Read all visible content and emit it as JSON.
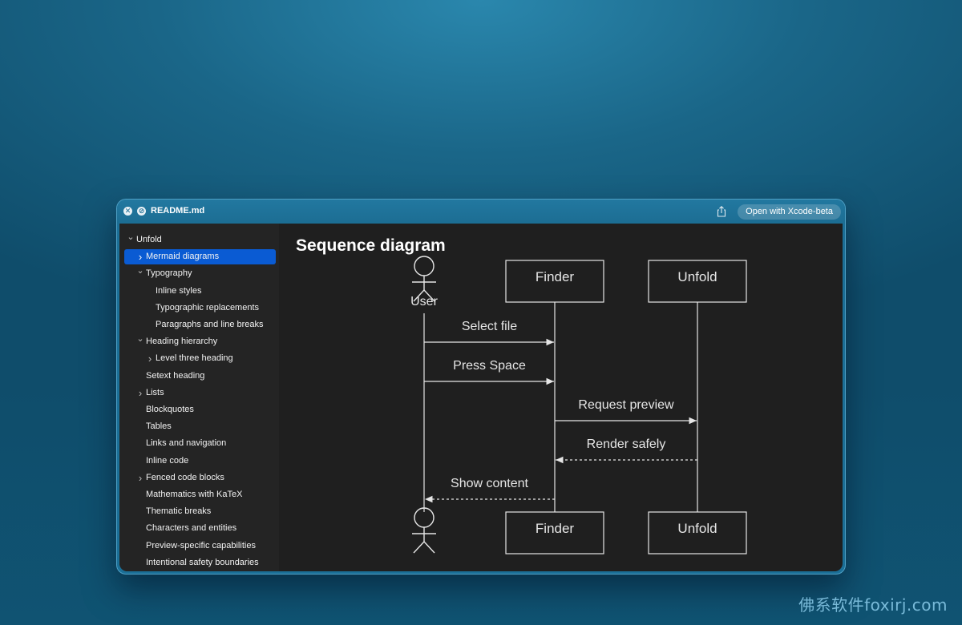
{
  "window": {
    "title": "README.md",
    "open_button_label": "Open with Xcode-beta"
  },
  "sidebar": {
    "items": [
      {
        "label": "Unfold",
        "level": 0,
        "chevron": "down"
      },
      {
        "label": "Mermaid diagrams",
        "level": 1,
        "chevron": "right",
        "selected": true
      },
      {
        "label": "Typography",
        "level": 1,
        "chevron": "down"
      },
      {
        "label": "Inline styles",
        "level": 2,
        "chevron": ""
      },
      {
        "label": "Typographic replacements",
        "level": 2,
        "chevron": ""
      },
      {
        "label": "Paragraphs and line breaks",
        "level": 2,
        "chevron": ""
      },
      {
        "label": "Heading hierarchy",
        "level": 1,
        "chevron": "down"
      },
      {
        "label": "Level three heading",
        "level": 2,
        "chevron": "right"
      },
      {
        "label": "Setext heading",
        "level": 1,
        "chevron": ""
      },
      {
        "label": "Lists",
        "level": 1,
        "chevron": "right"
      },
      {
        "label": "Blockquotes",
        "level": 1,
        "chevron": ""
      },
      {
        "label": "Tables",
        "level": 1,
        "chevron": ""
      },
      {
        "label": "Links and navigation",
        "level": 1,
        "chevron": ""
      },
      {
        "label": "Inline code",
        "level": 1,
        "chevron": ""
      },
      {
        "label": "Fenced code blocks",
        "level": 1,
        "chevron": "right"
      },
      {
        "label": "Mathematics with KaTeX",
        "level": 1,
        "chevron": ""
      },
      {
        "label": "Thematic breaks",
        "level": 1,
        "chevron": ""
      },
      {
        "label": "Characters and entities",
        "level": 1,
        "chevron": ""
      },
      {
        "label": "Preview-specific capabilities",
        "level": 1,
        "chevron": ""
      },
      {
        "label": "Intentional safety boundaries",
        "level": 1,
        "chevron": ""
      }
    ]
  },
  "main": {
    "heading": "Sequence diagram",
    "diagram": {
      "participants": [
        "User",
        "Finder",
        "Unfold"
      ],
      "messages": [
        {
          "from": "User",
          "to": "Finder",
          "label": "Select file",
          "style": "solid"
        },
        {
          "from": "User",
          "to": "Finder",
          "label": "Press Space",
          "style": "solid"
        },
        {
          "from": "Finder",
          "to": "Unfold",
          "label": "Request preview",
          "style": "solid"
        },
        {
          "from": "Unfold",
          "to": "Finder",
          "label": "Render safely",
          "style": "dashed"
        },
        {
          "from": "Finder",
          "to": "User",
          "label": "Show content",
          "style": "dashed"
        }
      ]
    }
  },
  "watermark": "佛系软件foxirj.com",
  "colors": {
    "selection": "#0a5bd3",
    "diagram_line": "#e6e6e6",
    "content_bg": "#1f1f1f"
  }
}
